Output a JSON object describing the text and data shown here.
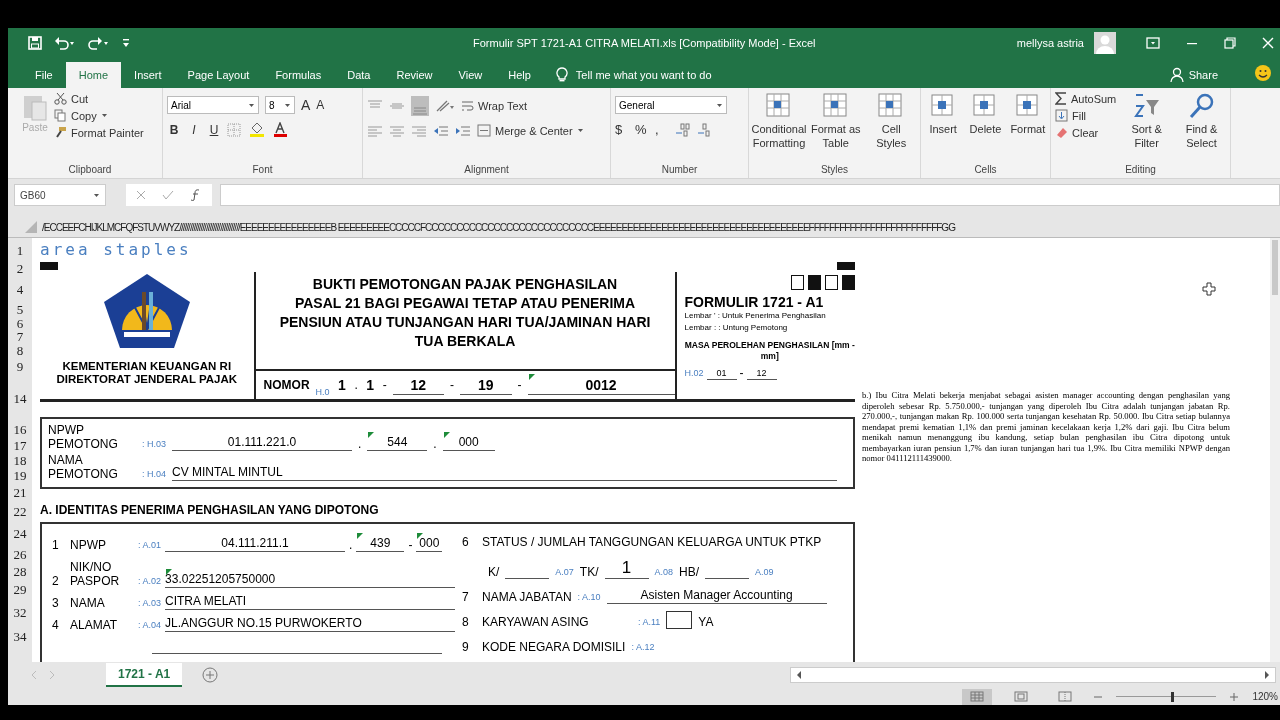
{
  "window": {
    "title": "Formulir SPT 1721-A1 CITRA MELATI.xls  [Compatibility Mode]  -  Excel",
    "user": "mellysa astria"
  },
  "ribbon_tabs": [
    {
      "label": "File",
      "selected": false
    },
    {
      "label": "Home",
      "selected": true
    },
    {
      "label": "Insert",
      "selected": false
    },
    {
      "label": "Page Layout",
      "selected": false
    },
    {
      "label": "Formulas",
      "selected": false
    },
    {
      "label": "Data",
      "selected": false
    },
    {
      "label": "Review",
      "selected": false
    },
    {
      "label": "View",
      "selected": false
    },
    {
      "label": "Help",
      "selected": false
    }
  ],
  "tell_me": "Tell me what you want to do",
  "share": "Share",
  "ribbon": {
    "clipboard": {
      "label": "Clipboard",
      "paste": {
        "label": "Paste",
        "disabled": true
      },
      "cut": "Cut",
      "copy": "Copy",
      "format_painter": "Format Painter"
    },
    "font": {
      "label": "Font",
      "family": "Arial",
      "size": "8",
      "grow": "A",
      "shrink": "A",
      "bold": "B",
      "italic": "I",
      "underline": "U"
    },
    "alignment": {
      "label": "Alignment",
      "wrap": "Wrap Text",
      "merge": "Merge & Center"
    },
    "number": {
      "label": "Number",
      "format": "General",
      "currency": "$",
      "percent": "%",
      "comma": ","
    },
    "styles": {
      "label": "Styles",
      "buttons": [
        "Conditional Formatting",
        "Format as Table",
        "Cell Styles"
      ]
    },
    "cells": {
      "label": "Cells",
      "buttons": [
        "Insert",
        "Delete",
        "Format"
      ]
    },
    "editing": {
      "label": "Editing",
      "autosum": "AutoSum",
      "fill": "Fill",
      "clear": "Clear",
      "buttons": [
        "Sort & Filter",
        "Find & Select"
      ]
    }
  },
  "formula_bar": {
    "name_box": "GB60"
  },
  "sheet": {
    "column_header": "/ECCEEFCHIJKLMCFQFSTUVWYZ//////////////////////////////////EEEEEEEEEEEEEEEEB EEEEEEEEECCCCCFCCCCCCCCCCCCCCCCCCCCCCCCCCCEEEEEEEEEEEEEEEEEEEEEEEEEEEEEEEEEEEEEEFFFFFFFFFFFFFFFFFFFFFFFFFFGG",
    "row_numbers": [
      "1",
      "2",
      "4",
      "5",
      "6",
      "7",
      "8",
      "9",
      "14",
      "16",
      "17",
      "18",
      "19",
      "21",
      "22",
      "24",
      "26",
      "28",
      "29",
      "32",
      "34"
    ],
    "caption": "area staples",
    "header": {
      "ministry": [
        "KEMENTERIAN KEUANGAN RI",
        "DIREKTORAT JENDERAL PAJAK"
      ],
      "title_lines": [
        "BUKTI PEMOTONGAN PAJAK PENGHASILAN",
        "PASAL 21 BAGI PEGAWAI TETAP ATAU PENERIMA",
        "PENSIUN ATAU TUNJANGAN HARI TUA/JAMINAN HARI",
        "TUA BERKALA"
      ],
      "nomor": {
        "label": "NOMOR",
        "code": "H.0",
        "parts": [
          {
            "value": "1",
            "sep": ".",
            "flagged": false
          },
          {
            "value": "1",
            "sep": "-",
            "flagged": false
          },
          {
            "value": "12",
            "sep": "-",
            "flagged": false
          },
          {
            "value": "19",
            "sep": "-",
            "flagged": false
          },
          {
            "value": "0012",
            "flagged": true
          }
        ]
      },
      "squares": [
        {
          "filled": false
        },
        {
          "filled": true
        },
        {
          "filled": false
        },
        {
          "filled": true
        }
      ],
      "formulir": "FORMULIR 1721 - A1",
      "lembar": [
        "Lembar ' :  Untuk Penerima Penghasilan",
        "Lembar : :  Untung Pemotong"
      ],
      "masa": {
        "label": "MASA PEROLEHAN PENGHASILAN [mm - mm]",
        "code": "H.02",
        "from": "01",
        "sep": "-",
        "to": "12"
      }
    },
    "pemotong": [
      {
        "label": [
          "NPWP",
          "PEMOTONG"
        ],
        "code": ": H.03",
        "parts": [
          {
            "value": "01.111.221.0",
            "flagged": false
          },
          {
            "sep": ".",
            "value": "544",
            "flagged": true
          },
          {
            "sep": ".",
            "value": "000",
            "flagged": true
          }
        ]
      },
      {
        "label": [
          "NAMA",
          "PEMOTONG"
        ],
        "code": ": H.04",
        "parts": [
          {
            "value": "CV MINTAL MINTUL",
            "flagged": false
          }
        ]
      }
    ],
    "section_a": {
      "title": "A. IDENTITAS PENERIMA PENGHASILAN YANG DIPOTONG",
      "left": [
        {
          "no": "1",
          "label": "NPWP",
          "code": ": A.01",
          "parts": [
            {
              "value": "04.111.211.1",
              "flagged": false
            },
            {
              "sep": ".",
              "value": "439",
              "flagged": true
            },
            {
              "sep": "-",
              "value": "000",
              "flagged": true
            }
          ]
        },
        {
          "no": "2",
          "label": "NIK/NO PASPOR",
          "code": ": A.02",
          "parts": [
            {
              "value": "33.02251205750000",
              "flagged": true
            }
          ]
        },
        {
          "no": "3",
          "label": "NAMA",
          "code": ": A.03",
          "parts": [
            {
              "value": "CITRA MELATI",
              "flagged": false
            }
          ]
        },
        {
          "no": "4",
          "label": "ALAMAT",
          "code": ": A.04",
          "parts": [
            {
              "value": "JL.ANGGUR NO.15 PURWOKERTO",
              "flagged": false
            }
          ]
        }
      ],
      "status": {
        "no": "6",
        "label": "STATUS / JUMLAH TANGGUNGAN KELUARGA UNTUK PTKP",
        "options": [
          {
            "label": "K/",
            "code": "A.07"
          },
          {
            "label": "TK/",
            "value": "1",
            "code": "A.08"
          },
          {
            "label": "HB/",
            "code": "A.09"
          }
        ]
      },
      "jabatan": {
        "no": "7",
        "label": "NAMA JABATAN",
        "code": ": A.10",
        "value": "Asisten Manager Accounting"
      },
      "asing": {
        "no": "8",
        "label": "KARYAWAN ASING",
        "code": ": A.11",
        "checked": false,
        "option": "YA"
      },
      "negara": {
        "no": "9",
        "label": "KODE NEGARA DOMISILI",
        "code": ": A.12"
      }
    },
    "note": "b.) Ibu Citra Melati bekerja menjabat sebagai asisten manager accounting dengan penghasilan yang diperoleh sebesar Rp. 5.750.000,- tunjangan yang diperoleh Ibu Citra adalah tunjangan jabatan Rp. 270.000,-, tunjangan makan Rp. 100.000 serta tunjangan kesehatan Rp. 50.000. Ibu Citra setiap bulannya mendapat premi kematian 1,1% dan premi jaminan kecelakaan kerja  1,2% dari gaji. Ibu Citra belum menikah namun menanggung ibu kandung, setiap bulan penghasilan ibu Citra dipotong untuk membayarkan iuran pensiun 1,7% dan iuran tunjangan hari tua 1,9%. Ibu Citra memiliki NPWP dengan nomor 041112111439000."
  },
  "sheet_tabs": [
    {
      "label": "1721 - A1",
      "selected": true
    }
  ],
  "status_bar": {
    "views": [
      {
        "kind": "normal",
        "selected": true
      },
      {
        "kind": "page_layout",
        "selected": false
      },
      {
        "kind": "page_break",
        "selected": false
      }
    ],
    "zoom": {
      "level": 0.55,
      "reading": "120%"
    }
  }
}
